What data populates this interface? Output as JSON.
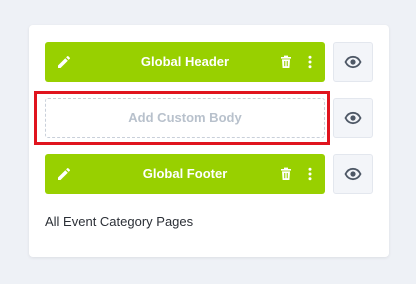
{
  "colors": {
    "accent": "#98d000",
    "highlight": "#e0141e",
    "placeholder_text": "#b8c1cc",
    "eye_icon": "#4e5866"
  },
  "layout_rows": [
    {
      "type": "assigned",
      "label": "Global Header",
      "icons": [
        "pencil-icon",
        "trash-icon",
        "kebab-menu-icon",
        "eye-icon"
      ]
    },
    {
      "type": "empty",
      "label": "Add Custom Body",
      "highlighted": true,
      "icons": [
        "eye-icon"
      ]
    },
    {
      "type": "assigned",
      "label": "Global Footer",
      "icons": [
        "pencil-icon",
        "trash-icon",
        "kebab-menu-icon",
        "eye-icon"
      ]
    }
  ],
  "caption": "All Event Category Pages"
}
